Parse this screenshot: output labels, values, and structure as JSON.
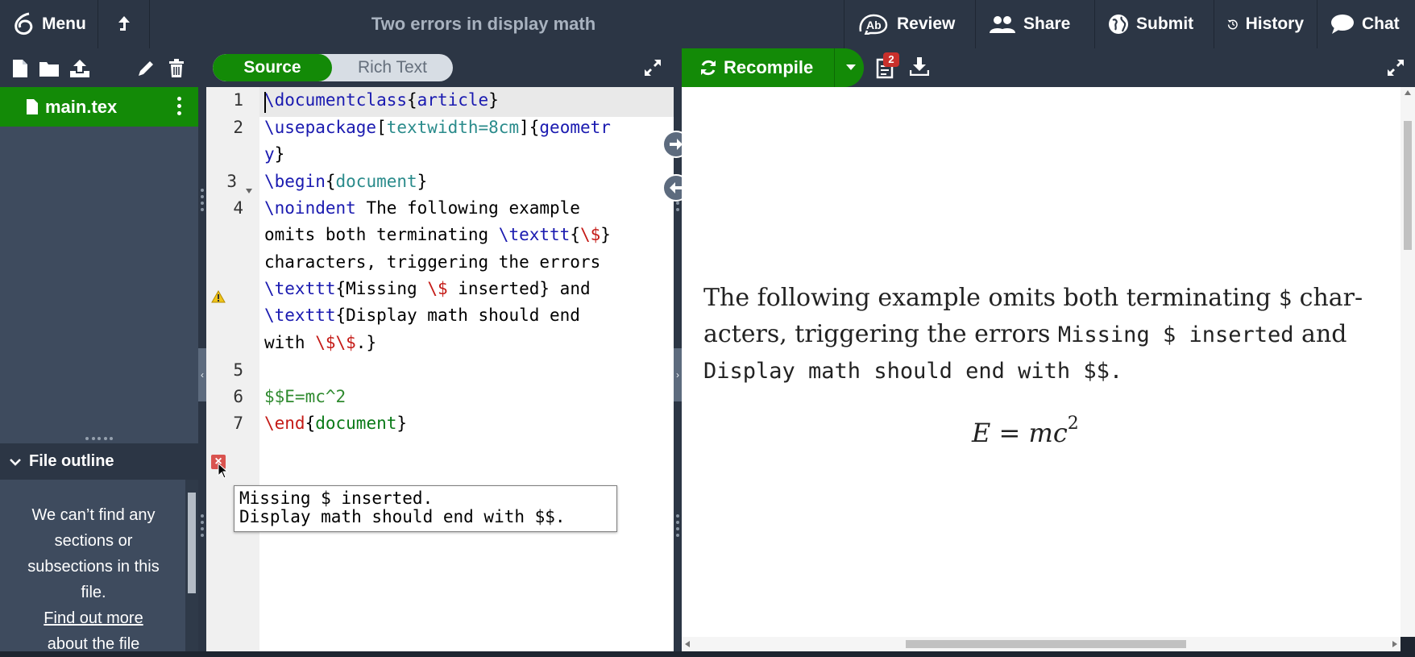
{
  "topbar": {
    "menu_label": "Menu",
    "title": "Two errors in display math",
    "buttons": {
      "review": "Review",
      "share": "Share",
      "submit": "Submit",
      "history": "History",
      "chat": "Chat"
    }
  },
  "file_tree": {
    "tools": [
      "new-file-icon",
      "new-folder-icon",
      "upload-icon",
      "rename-icon",
      "delete-icon"
    ],
    "files": [
      {
        "name": "main.tex",
        "selected": true
      }
    ]
  },
  "outline": {
    "title": "File outline",
    "empty_message": "We can’t find any sections or subsections in this file.",
    "link": "Find out more",
    "link_tail": "about the file"
  },
  "editor": {
    "mode_source": "Source",
    "mode_rich": "Rich Text",
    "line_numbers": [
      "1",
      "2",
      "3",
      "4",
      "5",
      "6",
      "7"
    ],
    "lines": [
      "\\documentclass{article}",
      "\\usepackage[textwidth=8cm]{geometry}",
      "\\begin{document}",
      "\\noindent The following example omits both terminating \\texttt{\\$} characters, triggering the errors \\texttt{Missing \\$ inserted} and \\texttt{Display math should end with \\$\\$.}",
      "",
      "$$E=mc^2",
      "\\end{document}"
    ],
    "tooltip": [
      "Missing $ inserted.",
      "Display math should end with $$."
    ]
  },
  "pdf": {
    "recompile_label": "Recompile",
    "log_badge": "2",
    "paragraph_parts": [
      "The following example omits both terminating ",
      "$",
      " char-acters, triggering the errors ",
      "Missing $ inserted",
      " and ",
      "Display math should end with $$."
    ],
    "equation": "E = mc",
    "equation_exp": "2"
  },
  "colors": {
    "topbar_bg": "#2c3645",
    "accent_green": "#138a07",
    "sidebar_bg": "#3e4b5e",
    "error_red": "#d9534f",
    "keyword_blue": "#1a1ab0",
    "math_green": "#0a7a18"
  }
}
